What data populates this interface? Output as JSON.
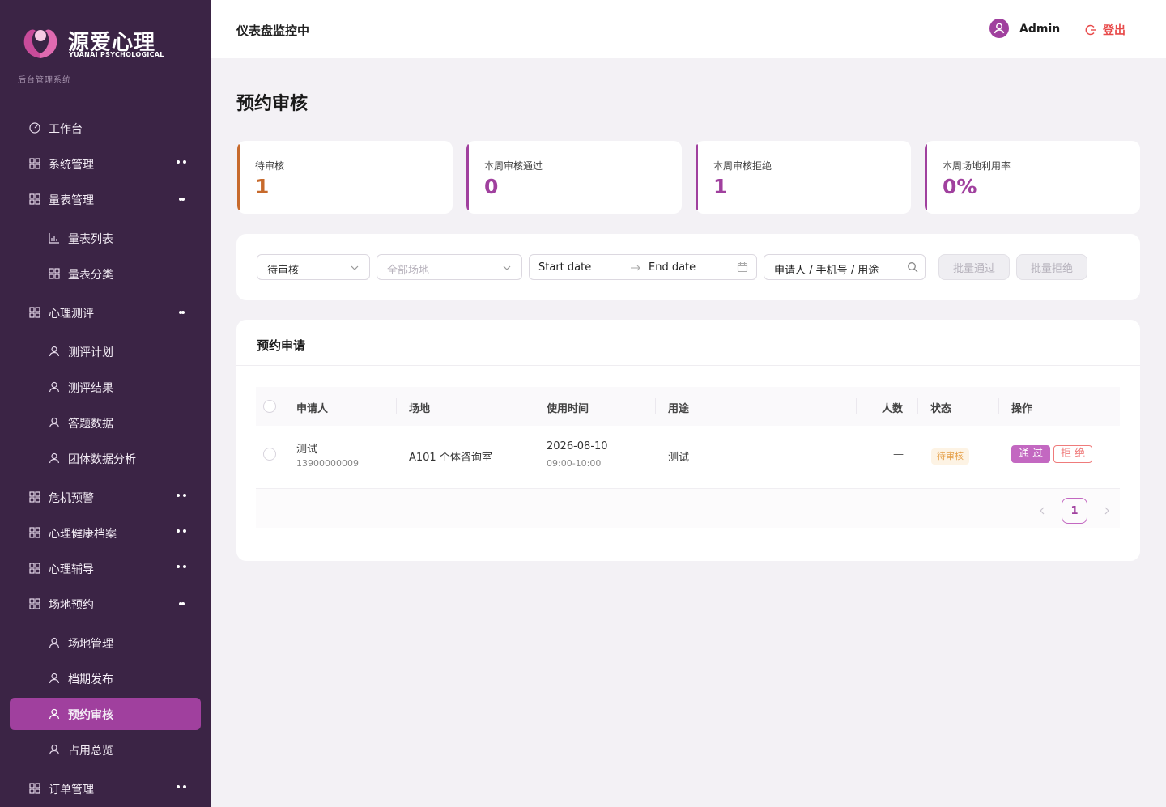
{
  "brand": {
    "name": "源爱心理",
    "english": "YUANAI PSYCHOLOGICAL",
    "subtitle": "后台管理系统"
  },
  "nav": [
    {
      "label": "工作台",
      "icon": "dashboard-icon",
      "level": 0
    },
    {
      "label": "系统管理",
      "icon": "grid-icon",
      "level": 0,
      "state": "collapsed"
    },
    {
      "label": "量表管理",
      "icon": "grid-icon",
      "level": 0,
      "state": "expanded"
    },
    {
      "label": "量表列表",
      "icon": "bar-chart-icon",
      "level": 1
    },
    {
      "label": "量表分类",
      "icon": "grid-icon",
      "level": 1
    },
    {
      "label": "心理测评",
      "icon": "grid-icon",
      "level": 0,
      "state": "expanded"
    },
    {
      "label": "测评计划",
      "icon": "user-icon",
      "level": 1
    },
    {
      "label": "测评结果",
      "icon": "user-icon",
      "level": 1
    },
    {
      "label": "答题数据",
      "icon": "user-icon",
      "level": 1
    },
    {
      "label": "团体数据分析",
      "icon": "user-icon",
      "level": 1
    },
    {
      "label": "危机预警",
      "icon": "grid-icon",
      "level": 0,
      "state": "collapsed"
    },
    {
      "label": "心理健康档案",
      "icon": "grid-icon",
      "level": 0,
      "state": "collapsed"
    },
    {
      "label": "心理辅导",
      "icon": "grid-icon",
      "level": 0,
      "state": "collapsed"
    },
    {
      "label": "场地预约",
      "icon": "grid-icon",
      "level": 0,
      "state": "expanded"
    },
    {
      "label": "场地管理",
      "icon": "user-icon",
      "level": 1
    },
    {
      "label": "档期发布",
      "icon": "user-icon",
      "level": 1
    },
    {
      "label": "预约审核",
      "icon": "user-icon",
      "level": 1,
      "active": true
    },
    {
      "label": "占用总览",
      "icon": "user-icon",
      "level": 1
    },
    {
      "label": "订单管理",
      "icon": "grid-icon",
      "level": 0,
      "state": "collapsed"
    }
  ],
  "header": {
    "title": "仪表盘监控中",
    "user": "Admin",
    "logout": "登出"
  },
  "page": {
    "title": "预约审核"
  },
  "stats": [
    {
      "label": "待审核",
      "value": "1",
      "color": "#c76a2c"
    },
    {
      "label": "本周审核通过",
      "value": "0",
      "color": "#a0409e"
    },
    {
      "label": "本周审核拒绝",
      "value": "1",
      "color": "#a0409e"
    },
    {
      "label": "本周场地利用率",
      "value": "0%",
      "color": "#a0409e"
    }
  ],
  "filters": {
    "status": "待审核",
    "venue_placeholder": "全部场地",
    "start_placeholder": "Start date",
    "end_placeholder": "End date",
    "search_placeholder": "申请人 / 手机号 / 用途",
    "batch_pass": "批量通过",
    "batch_reject": "批量拒绝"
  },
  "table": {
    "title": "预约申请",
    "columns": [
      "申请人",
      "场地",
      "使用时间",
      "用途",
      "人数",
      "状态",
      "操作"
    ],
    "rows": [
      {
        "applicant": "测试",
        "phone": "13900000009",
        "venue": "A101 个体咨询室",
        "date": "2026-08-10",
        "time": "09:00-10:00",
        "purpose": "测试",
        "people": "—",
        "status": "待审核",
        "pass": "通过",
        "reject": "拒绝"
      }
    ]
  },
  "pagination": {
    "current": "1"
  },
  "colors": {
    "sidebar_bg": "#3b2445",
    "accent": "#a0409e",
    "pending": "#c76a2c",
    "danger": "#e84a4a"
  }
}
